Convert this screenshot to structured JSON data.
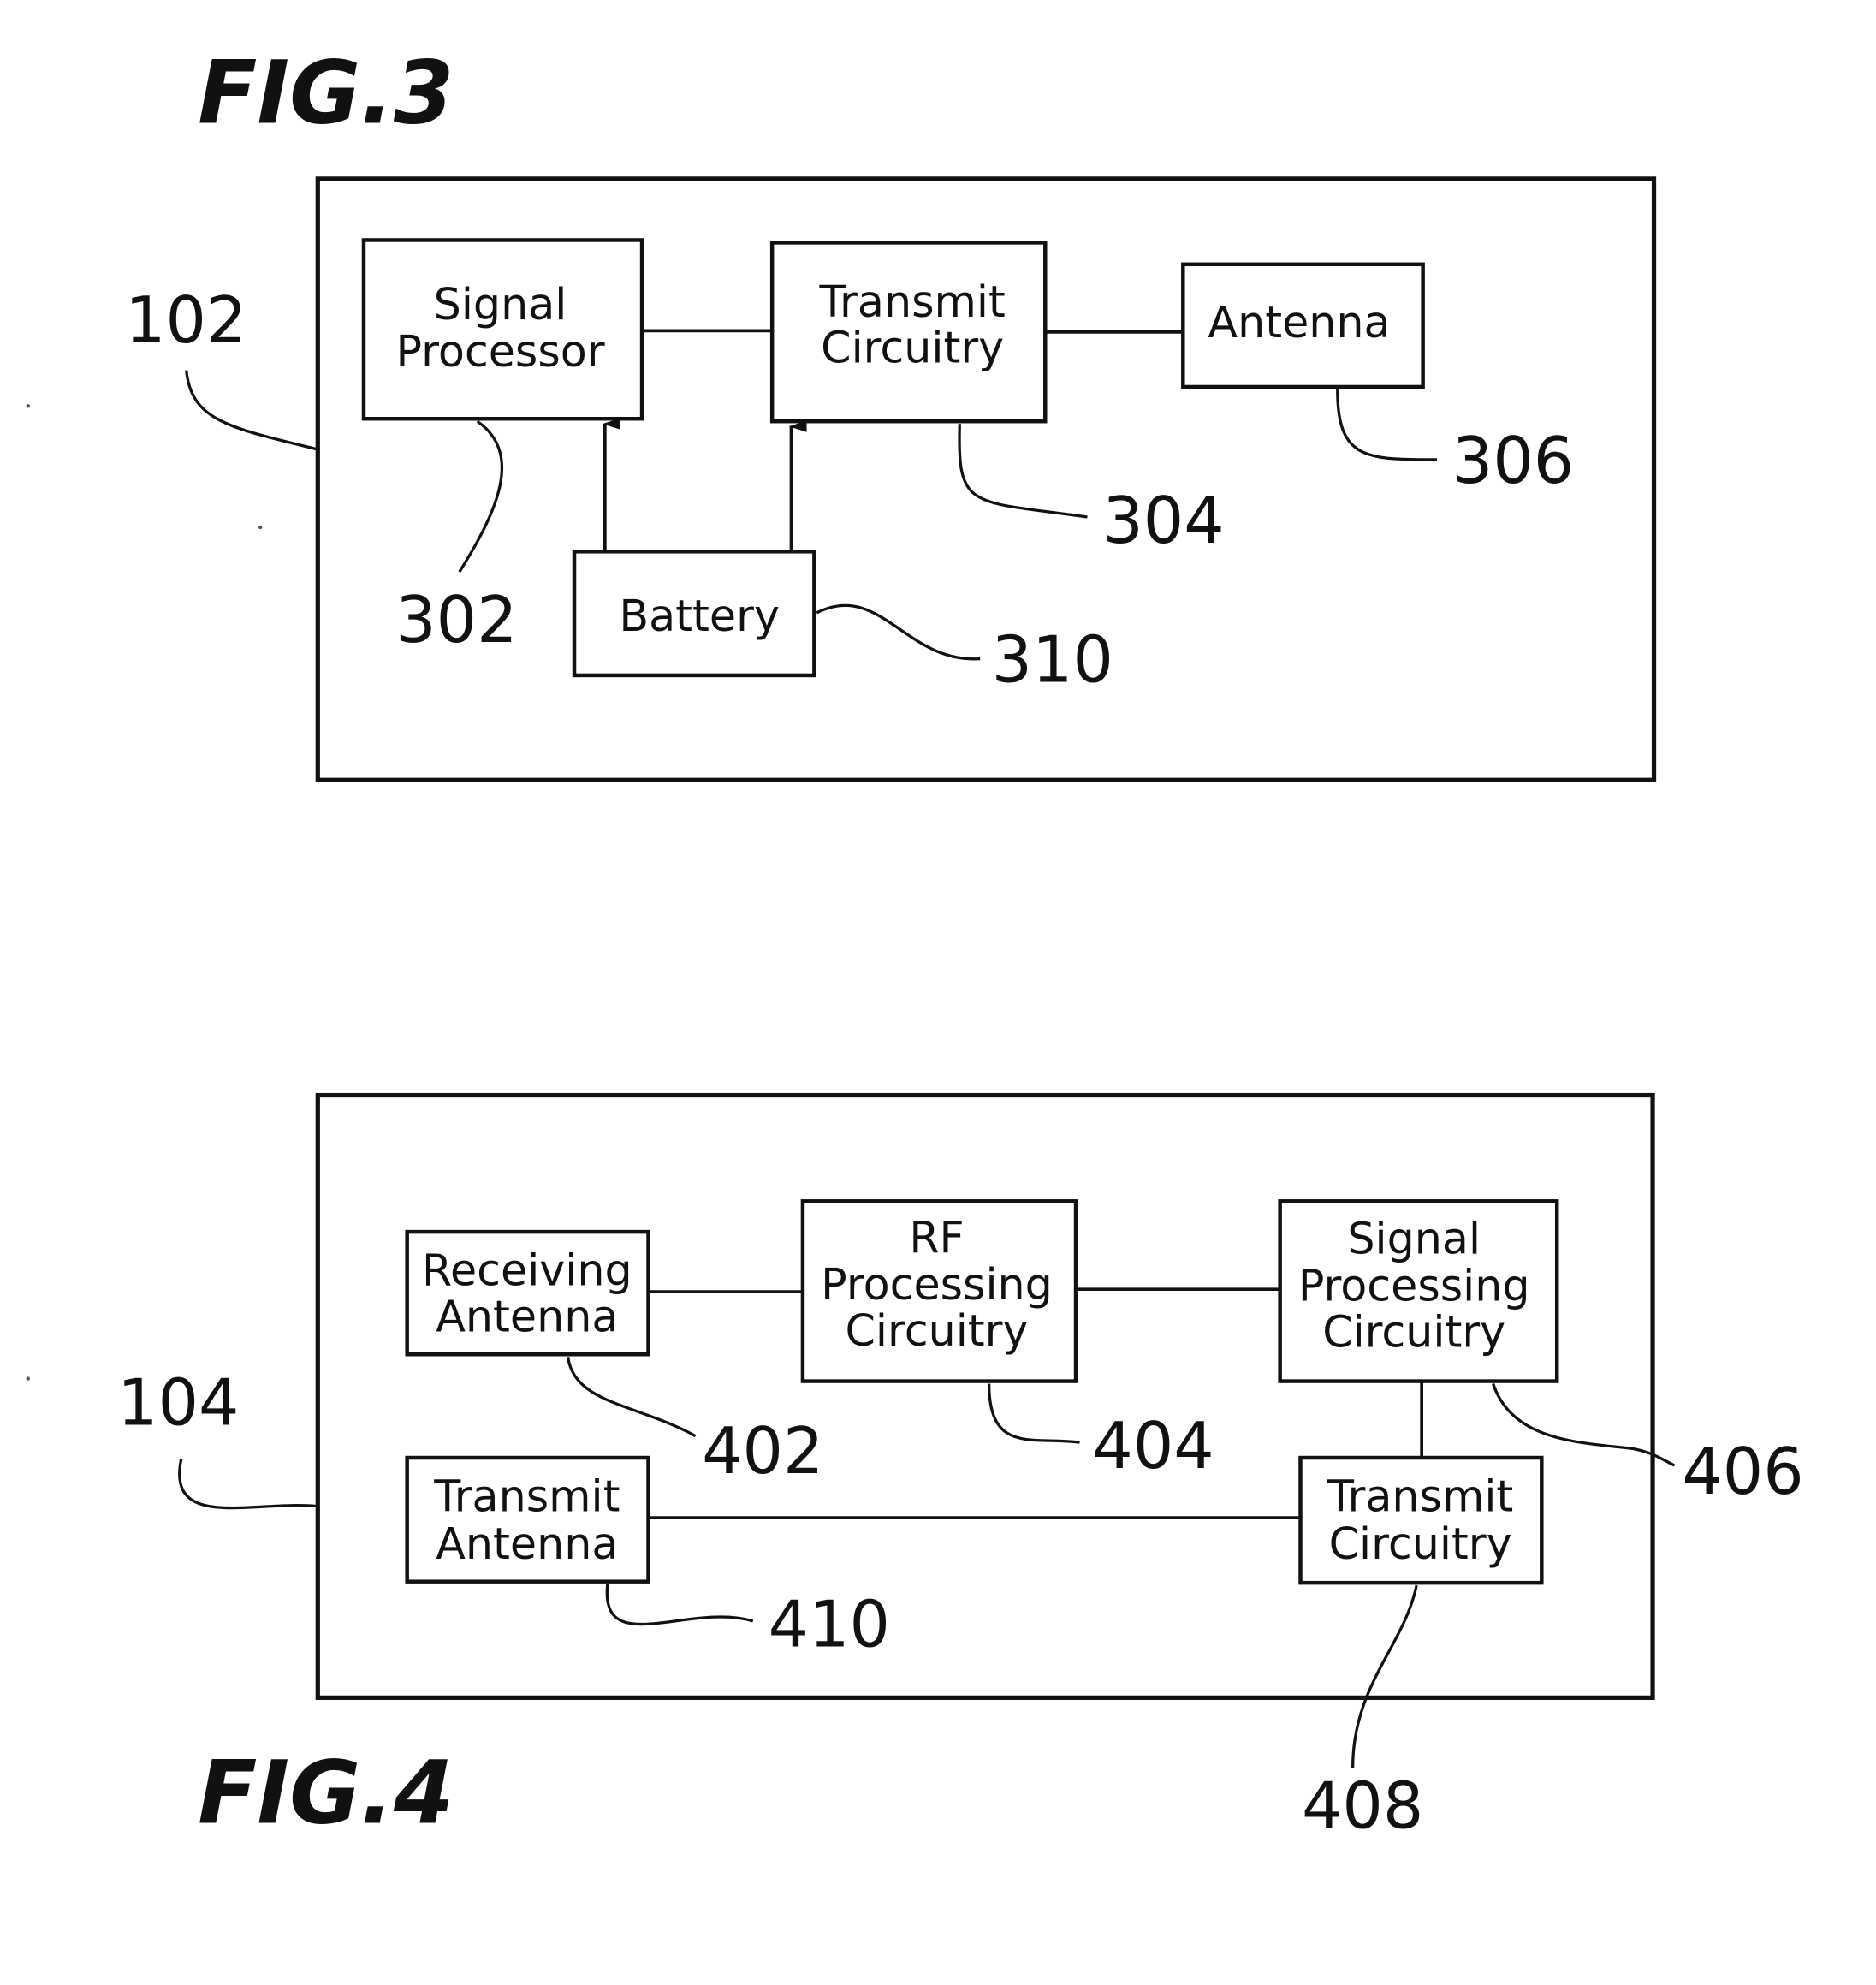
{
  "figures": [
    {
      "title": "FIG.3",
      "device_ref": "102",
      "blocks": [
        {
          "id": "signal-processor",
          "lines": [
            "Signal",
            "Processor"
          ],
          "ref": "302"
        },
        {
          "id": "transmit-circuitry",
          "lines": [
            "Transmit",
            "Circuitry"
          ],
          "ref": "304"
        },
        {
          "id": "antenna",
          "lines": [
            "Antenna"
          ],
          "ref": "306"
        },
        {
          "id": "battery",
          "lines": [
            "Battery"
          ],
          "ref": "310"
        }
      ],
      "connections": [
        {
          "from": "signal-processor",
          "to": "transmit-circuitry",
          "type": "line"
        },
        {
          "from": "transmit-circuitry",
          "to": "antenna",
          "type": "line"
        },
        {
          "from": "battery",
          "to": "signal-processor",
          "type": "arrow"
        },
        {
          "from": "battery",
          "to": "transmit-circuitry",
          "type": "arrow"
        }
      ]
    },
    {
      "title": "FIG.4",
      "device_ref": "104",
      "blocks": [
        {
          "id": "receiving-antenna",
          "lines": [
            "Receiving",
            "Antenna"
          ],
          "ref": "402"
        },
        {
          "id": "rf-processing-circuitry",
          "lines": [
            "RF",
            "Processing",
            "Circuitry"
          ],
          "ref": "404"
        },
        {
          "id": "signal-processing-circuitry",
          "lines": [
            "Signal",
            "Processing",
            "Circuitry"
          ],
          "ref": "406"
        },
        {
          "id": "transmit-circuitry",
          "lines": [
            "Transmit",
            "Circuitry"
          ],
          "ref": "408"
        },
        {
          "id": "transmit-antenna",
          "lines": [
            "Transmit",
            "Antenna"
          ],
          "ref": "410"
        }
      ],
      "connections": [
        {
          "from": "receiving-antenna",
          "to": "rf-processing-circuitry",
          "type": "line"
        },
        {
          "from": "rf-processing-circuitry",
          "to": "signal-processing-circuitry",
          "type": "line"
        },
        {
          "from": "signal-processing-circuitry",
          "to": "transmit-circuitry",
          "type": "line"
        },
        {
          "from": "transmit-circuitry",
          "to": "transmit-antenna",
          "type": "line"
        }
      ]
    }
  ]
}
